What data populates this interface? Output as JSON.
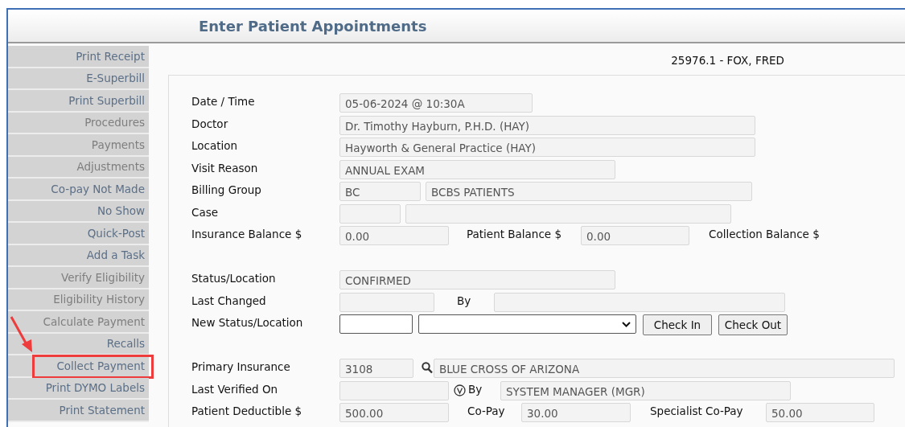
{
  "window": {
    "title": "Enter Patient Appointments"
  },
  "sidebar": {
    "items": [
      {
        "label": "Print Receipt",
        "disabled": false,
        "highlighted": false
      },
      {
        "label": "E-Superbill",
        "disabled": false,
        "highlighted": false
      },
      {
        "label": "Print Superbill",
        "disabled": false,
        "highlighted": false
      },
      {
        "label": "Procedures",
        "disabled": true,
        "highlighted": false
      },
      {
        "label": "Payments",
        "disabled": true,
        "highlighted": false
      },
      {
        "label": "Adjustments",
        "disabled": true,
        "highlighted": false
      },
      {
        "label": "Co-pay Not Made",
        "disabled": false,
        "highlighted": false
      },
      {
        "label": "No Show",
        "disabled": false,
        "highlighted": false
      },
      {
        "label": "Quick-Post",
        "disabled": false,
        "highlighted": false
      },
      {
        "label": "Add a Task",
        "disabled": false,
        "highlighted": false
      },
      {
        "label": "Verify Eligibility",
        "disabled": true,
        "highlighted": false
      },
      {
        "label": "Eligibility History",
        "disabled": true,
        "highlighted": false
      },
      {
        "label": "Calculate Payment",
        "disabled": true,
        "highlighted": false
      },
      {
        "label": "Recalls",
        "disabled": false,
        "highlighted": false
      },
      {
        "label": "Collect Payment",
        "disabled": false,
        "highlighted": true
      },
      {
        "label": "Print DYMO Labels",
        "disabled": false,
        "highlighted": false
      },
      {
        "label": "Print Statement",
        "disabled": false,
        "highlighted": false
      }
    ]
  },
  "patient": {
    "header": "25976.1 - FOX, FRED"
  },
  "form": {
    "rows": [
      {
        "cells": [
          {
            "kind": "label",
            "text": "Date / Time"
          },
          {
            "kind": "field",
            "value": "05-06-2024 @ 10:30A"
          }
        ]
      },
      {
        "cells": [
          {
            "kind": "label",
            "text": "Doctor"
          },
          {
            "kind": "field",
            "value": "Dr. Timothy Hayburn, P.H.D. (HAY)"
          }
        ]
      },
      {
        "cells": [
          {
            "kind": "label",
            "text": "Location"
          },
          {
            "kind": "field",
            "value": "Hayworth & General Practice (HAY)"
          }
        ]
      },
      {
        "cells": [
          {
            "kind": "label",
            "text": "Visit Reason"
          },
          {
            "kind": "field",
            "value": "ANNUAL EXAM"
          }
        ]
      },
      {
        "cells": [
          {
            "kind": "label",
            "text": "Billing Group"
          },
          {
            "kind": "field",
            "value": "BC"
          },
          {
            "kind": "field",
            "value": "BCBS PATIENTS"
          }
        ]
      },
      {
        "cells": [
          {
            "kind": "label",
            "text": "Case"
          },
          {
            "kind": "field"
          },
          {
            "kind": "field"
          }
        ]
      },
      {
        "cells": [
          {
            "kind": "label",
            "text": "Insurance Balance $"
          },
          {
            "kind": "field",
            "value": "0.00"
          },
          {
            "kind": "label",
            "text": "Patient Balance $"
          },
          {
            "kind": "field",
            "value": "0.00"
          },
          {
            "kind": "label",
            "text": "Collection Balance $"
          }
        ]
      },
      {
        "cells": []
      },
      {
        "cells": [
          {
            "kind": "label",
            "text": "Status/Location"
          },
          {
            "kind": "field",
            "value": "CONFIRMED"
          }
        ]
      },
      {
        "cells": [
          {
            "kind": "label",
            "text": "Last Changed"
          },
          {
            "kind": "field"
          },
          {
            "kind": "label",
            "text": "By"
          },
          {
            "kind": "field"
          }
        ]
      },
      {
        "cells": [
          {
            "kind": "label",
            "text": "New Status/Location"
          },
          {
            "kind": "input"
          },
          {
            "kind": "select"
          },
          {
            "kind": "button",
            "text": "Check In"
          },
          {
            "kind": "button",
            "text": "Check Out"
          }
        ]
      },
      {
        "cells": []
      },
      {
        "cells": [
          {
            "kind": "label",
            "text": "Primary Insurance"
          },
          {
            "kind": "field",
            "value": "3108"
          },
          {
            "kind": "search"
          },
          {
            "kind": "field",
            "value": "BLUE CROSS OF ARIZONA"
          }
        ]
      },
      {
        "cells": [
          {
            "kind": "label",
            "text": "Last Verified On"
          },
          {
            "kind": "field"
          },
          {
            "kind": "verify"
          },
          {
            "kind": "label",
            "text": "By"
          },
          {
            "kind": "field",
            "value": "SYSTEM MANAGER (MGR)"
          }
        ]
      },
      {
        "cells": [
          {
            "kind": "label",
            "text": "Patient Deductible $"
          },
          {
            "kind": "field",
            "value": "500.00"
          },
          {
            "kind": "label",
            "text": "Co-Pay"
          },
          {
            "kind": "field",
            "value": "30.00"
          },
          {
            "kind": "label",
            "text": "Specialist Co-Pay"
          },
          {
            "kind": "field",
            "value": "50.00"
          }
        ]
      }
    ]
  }
}
